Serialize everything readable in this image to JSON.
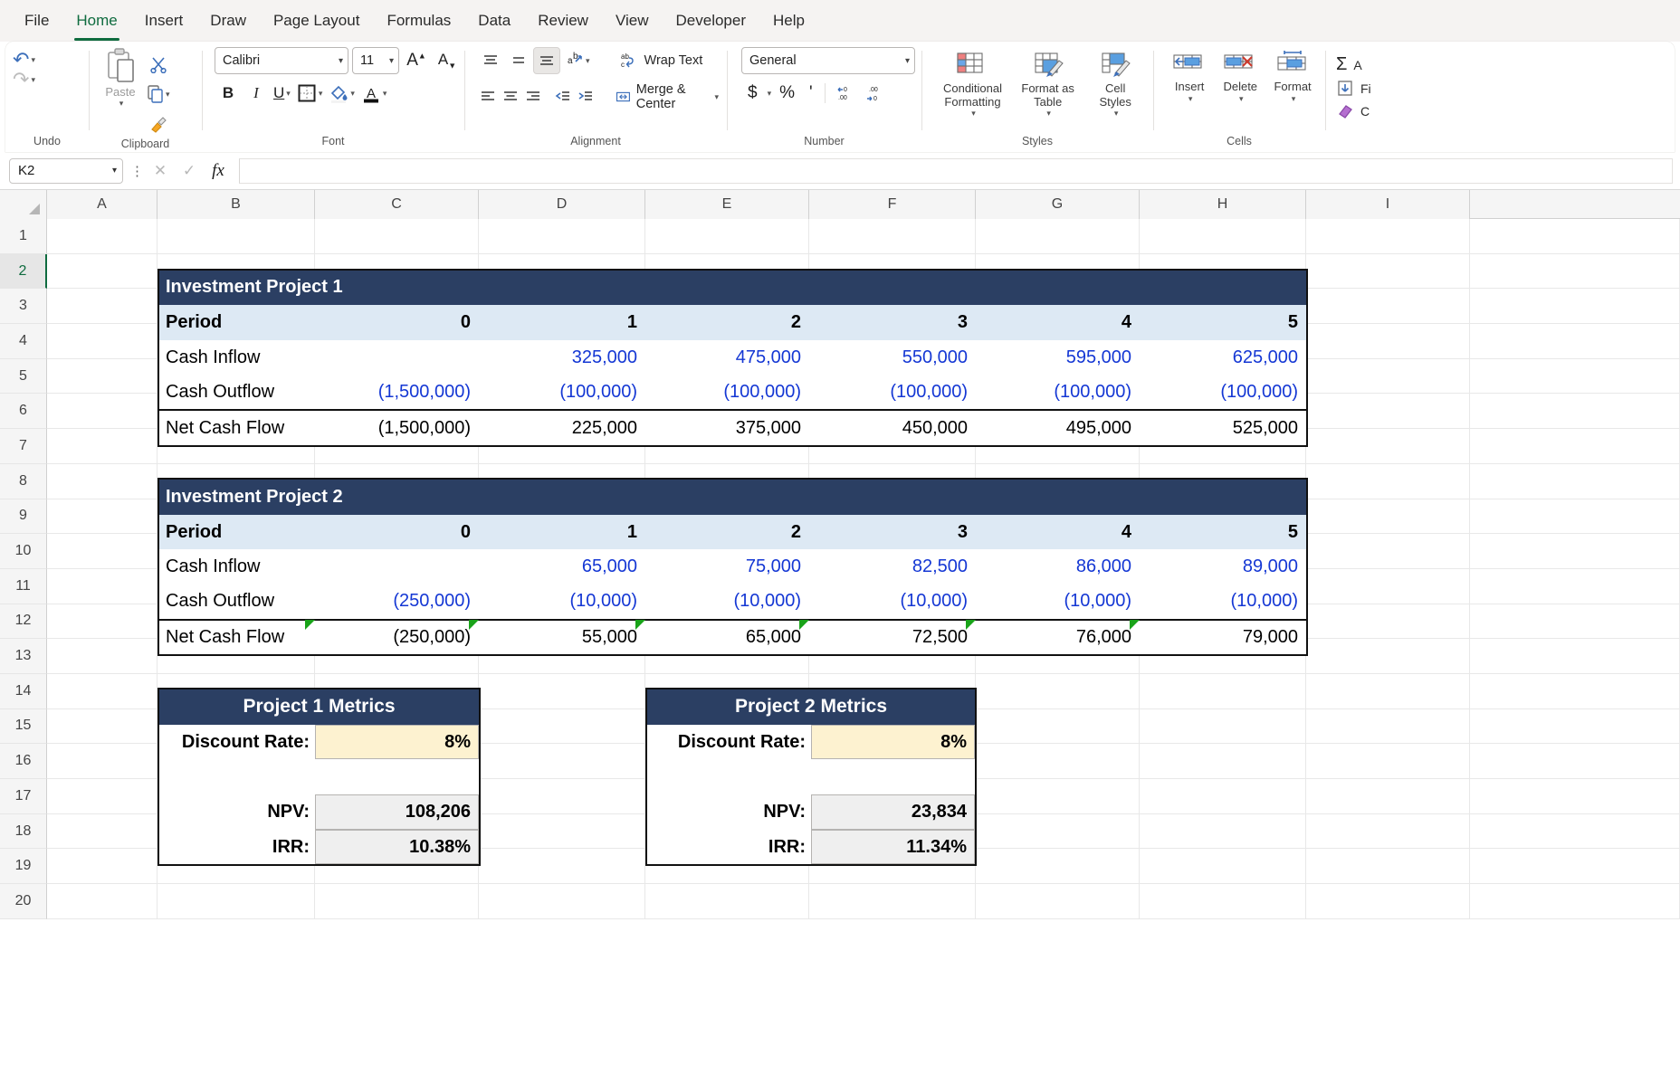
{
  "ribbon": {
    "tabs": [
      {
        "label": "File",
        "active": false
      },
      {
        "label": "Home",
        "active": true
      },
      {
        "label": "Insert",
        "active": false
      },
      {
        "label": "Draw",
        "active": false
      },
      {
        "label": "Page Layout",
        "active": false
      },
      {
        "label": "Formulas",
        "active": false
      },
      {
        "label": "Data",
        "active": false
      },
      {
        "label": "Review",
        "active": false
      },
      {
        "label": "View",
        "active": false
      },
      {
        "label": "Developer",
        "active": false
      },
      {
        "label": "Help",
        "active": false
      }
    ],
    "groups": {
      "undo": {
        "label": "Undo",
        "undo_icon": "undo-arrow",
        "redo_icon": "redo-arrow"
      },
      "clipboard": {
        "label": "Clipboard",
        "paste_label": "Paste",
        "cut_icon": "scissors-icon",
        "copy_icon": "copy-icon",
        "format_painter_icon": "paintbrush-icon"
      },
      "font": {
        "label": "Font",
        "font_name": "Calibri",
        "font_size": "11",
        "grow_label": "A",
        "shrink_label": "A",
        "bold": "B",
        "italic": "I",
        "underline": "U",
        "borders_icon": "borders-icon",
        "fill_icon": "fill-color-icon",
        "font_color_icon": "font-color-icon"
      },
      "alignment": {
        "label": "Alignment",
        "wrap_text": "Wrap Text",
        "merge_center": "Merge & Center",
        "orientation_icon": "orientation-icon"
      },
      "number": {
        "label": "Number",
        "format": "General",
        "currency": "$",
        "percent": "%",
        "comma": "'",
        "decrease_decimal": ".00",
        "increase_decimal": ".00"
      },
      "styles": {
        "label": "Styles",
        "conditional_formatting": "Conditional Formatting",
        "format_as_table": "Format as Table",
        "cell_styles": "Cell Styles"
      },
      "cells": {
        "label": "Cells",
        "insert": "Insert",
        "delete": "Delete",
        "format": "Format"
      },
      "editing": {
        "autosum": "A",
        "fill": "Fi",
        "clear": "C"
      }
    }
  },
  "formula_bar": {
    "name_box": "K2",
    "formula": "",
    "cancel_icon": "cancel-x-icon",
    "enter_icon": "enter-check-icon",
    "fx_icon": "fx-icon"
  },
  "grid": {
    "columns": [
      "A",
      "B",
      "C",
      "D",
      "E",
      "F",
      "G",
      "H",
      "I"
    ],
    "rows": [
      "1",
      "2",
      "3",
      "4",
      "5",
      "6",
      "7",
      "8",
      "9",
      "10",
      "11",
      "12",
      "13",
      "14",
      "15",
      "16",
      "17",
      "18",
      "19",
      "20"
    ],
    "selected_row": "2"
  },
  "project1": {
    "title": "Investment Project 1",
    "row_labels": [
      "Period",
      "Cash Inflow",
      "Cash Outflow",
      "Net Cash Flow"
    ],
    "periods": [
      "0",
      "1",
      "2",
      "3",
      "4",
      "5"
    ],
    "cash_inflow": [
      "",
      "325,000",
      "475,000",
      "550,000",
      "595,000",
      "625,000"
    ],
    "cash_outflow": [
      "(1,500,000)",
      "(100,000)",
      "(100,000)",
      "(100,000)",
      "(100,000)",
      "(100,000)"
    ],
    "net_cash_flow": [
      "(1,500,000)",
      "225,000",
      "375,000",
      "450,000",
      "495,000",
      "525,000"
    ]
  },
  "project2": {
    "title": "Investment Project 2",
    "row_labels": [
      "Period",
      "Cash Inflow",
      "Cash Outflow",
      "Net Cash Flow"
    ],
    "periods": [
      "0",
      "1",
      "2",
      "3",
      "4",
      "5"
    ],
    "cash_inflow": [
      "",
      "65,000",
      "75,000",
      "82,500",
      "86,000",
      "89,000"
    ],
    "cash_outflow": [
      "(250,000)",
      "(10,000)",
      "(10,000)",
      "(10,000)",
      "(10,000)",
      "(10,000)"
    ],
    "net_cash_flow": [
      "(250,000)",
      "55,000",
      "65,000",
      "72,500",
      "76,000",
      "79,000"
    ],
    "comment_markers": 6
  },
  "metrics1": {
    "title": "Project 1 Metrics",
    "discount_rate_label": "Discount Rate:",
    "discount_rate_value": "8%",
    "npv_label": "NPV:",
    "npv_value": "108,206",
    "irr_label": "IRR:",
    "irr_value": "10.38%"
  },
  "metrics2": {
    "title": "Project 2 Metrics",
    "discount_rate_label": "Discount Rate:",
    "discount_rate_value": "8%",
    "npv_label": "NPV:",
    "npv_value": "23,834",
    "irr_label": "IRR:",
    "irr_value": "11.34%"
  },
  "colors": {
    "header_navy": "#2b3f63",
    "period_blue": "#dde9f4",
    "input_blue": "#1437d4",
    "rate_cream": "#fdf2d0",
    "calc_gray": "#efefef",
    "comment_green": "#19a319",
    "excel_green": "#0f6b3f"
  }
}
